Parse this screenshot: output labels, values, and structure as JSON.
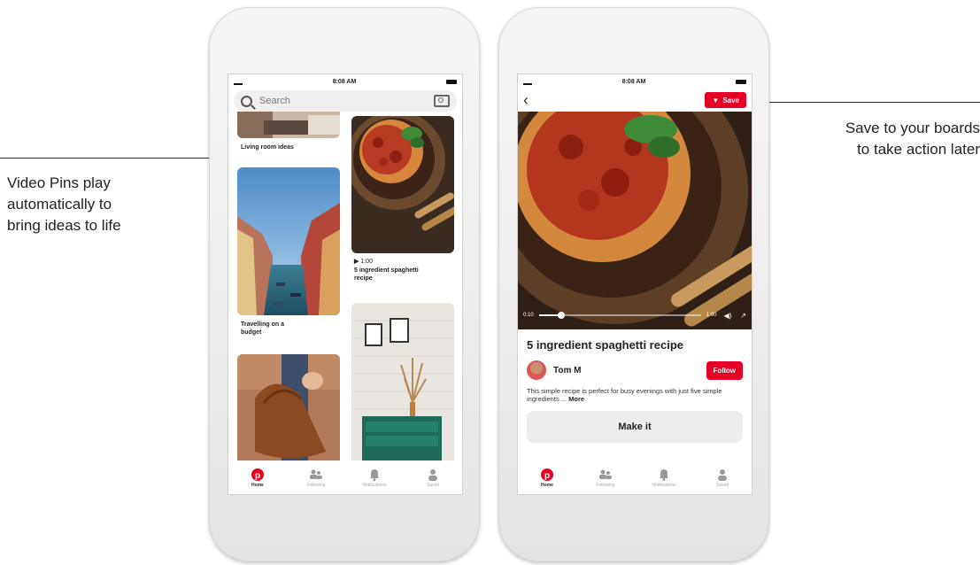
{
  "callouts": {
    "left": [
      "Video Pins play",
      "automatically to",
      "bring ideas to life"
    ],
    "right": [
      "Save to your boards",
      "to take action later"
    ]
  },
  "status": {
    "time": "8:08 AM"
  },
  "home": {
    "search_placeholder": "Search",
    "pins": [
      {
        "label": "Living room ideas"
      },
      {
        "label": "Travelling on a budget"
      },
      {
        "duration": "1:00",
        "label": "5 ingredient spaghetti recipe"
      }
    ]
  },
  "detail": {
    "save_label": "Save",
    "video": {
      "current": "0:10",
      "total": "1:00",
      "progress": 0.14
    },
    "title": "5 ingredient spaghetti recipe",
    "author": "Tom M",
    "follow_label": "Follow",
    "description": "This simple recipe is perfect for busy evenings with just five simple ingredients ...",
    "more_label": "More",
    "make_it_label": "Make it"
  },
  "tabs": [
    {
      "label": "Home",
      "icon": "pinterest-logo-icon"
    },
    {
      "label": "Following",
      "icon": "people-icon"
    },
    {
      "label": "Notifications",
      "icon": "bell-icon"
    },
    {
      "label": "Saved",
      "icon": "person-icon"
    }
  ],
  "colors": {
    "brand_red": "#e60023"
  }
}
